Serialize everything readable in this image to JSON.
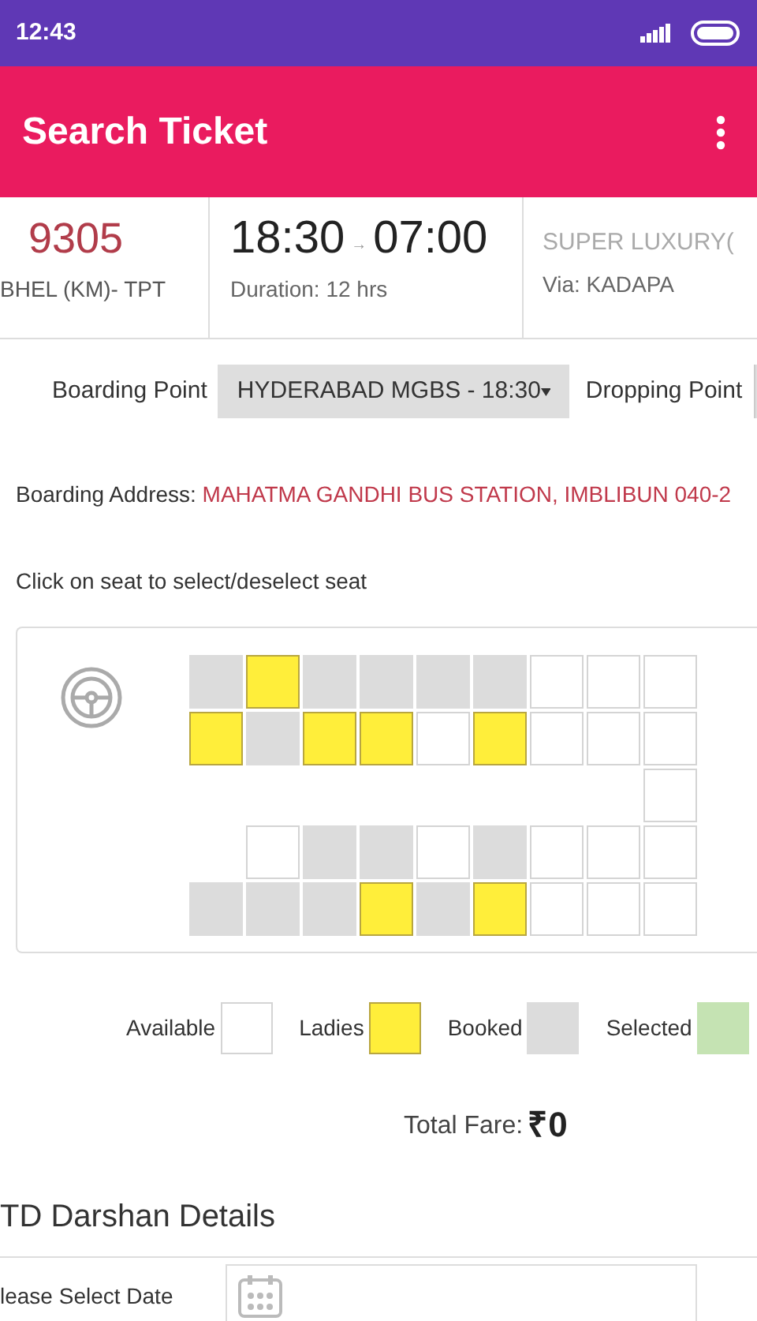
{
  "status_bar": {
    "time": "12:43"
  },
  "app_bar": {
    "title": "Search Ticket"
  },
  "service": {
    "number": "9305",
    "route": "BHEL (KM)- TPT",
    "departure": "18:30",
    "arrow": "→",
    "arrival": "07:00",
    "duration": "Duration: 12 hrs",
    "type": "SUPER LUXURY(",
    "via": "Via: KADAPA"
  },
  "boarding": {
    "label": "Boarding Point",
    "value": "HYDERABAD MGBS - 18:30",
    "dropping_label": "Dropping Point"
  },
  "address": {
    "label": "Boarding Address:",
    "value": "MAHATMA GANDHI BUS STATION, IMBLIBUN 040-2"
  },
  "instruction": "Click on seat to select/deselect seat",
  "seat_rows": [
    {
      "seats": [
        {
          "kind": "booked"
        },
        {
          "kind": "ladies"
        },
        {
          "kind": "booked"
        },
        {
          "kind": "booked"
        },
        {
          "kind": "booked"
        },
        {
          "kind": "booked"
        },
        {
          "kind": "available"
        },
        {
          "kind": "available"
        },
        {
          "kind": "available"
        }
      ]
    },
    {
      "seats": [
        {
          "kind": "ladies"
        },
        {
          "kind": "booked"
        },
        {
          "kind": "ladies"
        },
        {
          "kind": "ladies"
        },
        {
          "kind": "available"
        },
        {
          "kind": "ladies"
        },
        {
          "kind": "available"
        },
        {
          "kind": "available"
        },
        {
          "kind": "available"
        }
      ]
    },
    {
      "seats": [
        {
          "kind": "aisle"
        },
        {
          "kind": "aisle"
        },
        {
          "kind": "aisle"
        },
        {
          "kind": "aisle"
        },
        {
          "kind": "aisle"
        },
        {
          "kind": "aisle"
        },
        {
          "kind": "aisle"
        },
        {
          "kind": "aisle"
        },
        {
          "kind": "available"
        }
      ]
    },
    {
      "seats": [
        {
          "kind": "aisle"
        },
        {
          "kind": "available"
        },
        {
          "kind": "booked"
        },
        {
          "kind": "booked"
        },
        {
          "kind": "available"
        },
        {
          "kind": "booked"
        },
        {
          "kind": "available"
        },
        {
          "kind": "available"
        },
        {
          "kind": "available"
        }
      ]
    },
    {
      "seats": [
        {
          "kind": "booked"
        },
        {
          "kind": "booked"
        },
        {
          "kind": "booked"
        },
        {
          "kind": "ladies"
        },
        {
          "kind": "booked"
        },
        {
          "kind": "ladies"
        },
        {
          "kind": "available"
        },
        {
          "kind": "available"
        },
        {
          "kind": "available"
        }
      ]
    }
  ],
  "legend": [
    {
      "label": "Available",
      "kind": "available"
    },
    {
      "label": "Ladies",
      "kind": "ladies"
    },
    {
      "label": "Booked",
      "kind": "booked"
    },
    {
      "label": "Selected",
      "kind": "selected"
    }
  ],
  "total_fare": {
    "label": "Total Fare:",
    "amount": "₹0"
  },
  "darshan": {
    "title": "TD Darshan Details",
    "date_label": "lease Select Date"
  }
}
